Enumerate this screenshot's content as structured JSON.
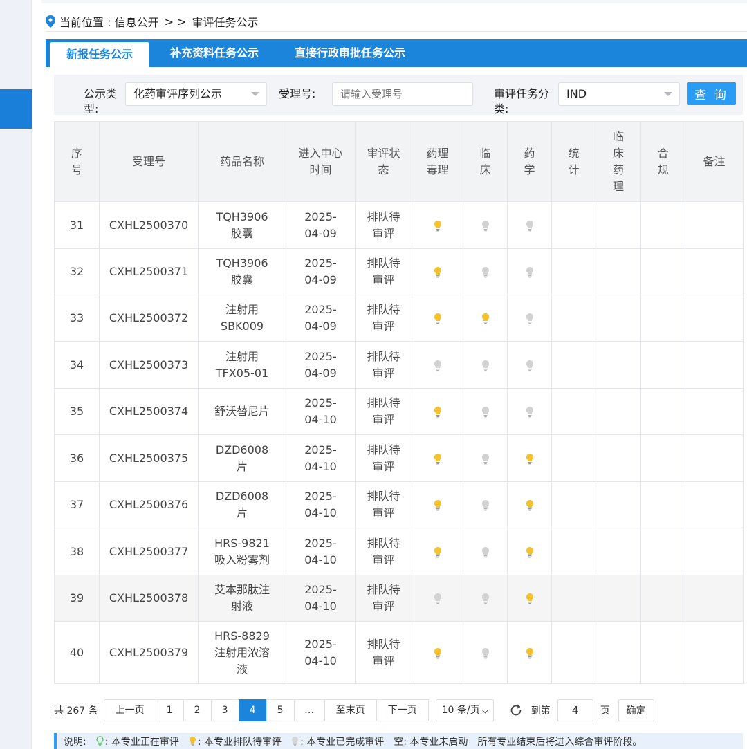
{
  "breadcrumb": {
    "prefix": "当前位置 : 信息公开",
    "sep": "> >",
    "current": "审评任务公示"
  },
  "tabs": [
    "新报任务公示",
    "补充资料任务公示",
    "直接行政审批任务公示"
  ],
  "filter": {
    "type_label": "公示类型:",
    "type_value": "化药审评序列公示",
    "accept_label": "受理号:",
    "accept_placeholder": "请输入受理号",
    "task_label": "审评任务分类:",
    "task_value": "IND",
    "query_button": "查 询"
  },
  "table": {
    "headers": [
      "序号",
      "受理号",
      "药品名称",
      "进入中心时间",
      "审评状态",
      "药理毒理",
      "临床",
      "药学",
      "统计",
      "临床药理",
      "合规",
      "备注"
    ],
    "rows": [
      {
        "no": "31",
        "id": "CXHL2500370",
        "name": "TQH3906胶囊",
        "date": "2025-04-09",
        "status": "排队待审评",
        "tox": "queued",
        "clinic": "done",
        "pharm": "done"
      },
      {
        "no": "32",
        "id": "CXHL2500371",
        "name": "TQH3906胶囊",
        "date": "2025-04-09",
        "status": "排队待审评",
        "tox": "queued",
        "clinic": "done",
        "pharm": "done"
      },
      {
        "no": "33",
        "id": "CXHL2500372",
        "name": "注射用SBK009",
        "date": "2025-04-09",
        "status": "排队待审评",
        "tox": "queued",
        "clinic": "queued",
        "pharm": "done"
      },
      {
        "no": "34",
        "id": "CXHL2500373",
        "name": "注射用TFX05-01",
        "date": "2025-04-09",
        "status": "排队待审评",
        "tox": "done",
        "clinic": "done",
        "pharm": "done"
      },
      {
        "no": "35",
        "id": "CXHL2500374",
        "name": "舒沃替尼片",
        "date": "2025-04-10",
        "status": "排队待审评",
        "tox": "queued",
        "clinic": "done",
        "pharm": "done"
      },
      {
        "no": "36",
        "id": "CXHL2500375",
        "name": "DZD6008片",
        "date": "2025-04-10",
        "status": "排队待审评",
        "tox": "queued",
        "clinic": "done",
        "pharm": "queued"
      },
      {
        "no": "37",
        "id": "CXHL2500376",
        "name": "DZD6008片",
        "date": "2025-04-10",
        "status": "排队待审评",
        "tox": "queued",
        "clinic": "done",
        "pharm": "queued"
      },
      {
        "no": "38",
        "id": "CXHL2500377",
        "name": "HRS-9821吸入粉雾剂",
        "date": "2025-04-10",
        "status": "排队待审评",
        "tox": "queued",
        "clinic": "done",
        "pharm": "queued"
      },
      {
        "no": "39",
        "id": "CXHL2500378",
        "name": "艾本那肽注射液",
        "date": "2025-04-10",
        "status": "排队待审评",
        "tox": "done",
        "clinic": "done",
        "pharm": "queued"
      },
      {
        "no": "40",
        "id": "CXHL2500379",
        "name": "HRS-8829注射用浓溶液",
        "date": "2025-04-10",
        "status": "排队待审评",
        "tox": "queued",
        "clinic": "done",
        "pharm": "queued"
      }
    ]
  },
  "pager": {
    "total": "共 267 条",
    "prev": "上一页",
    "pages": [
      "1",
      "2",
      "3",
      "4",
      "5",
      "…"
    ],
    "current": "4",
    "last": "至末页",
    "next": "下一页",
    "page_size": "10 条/页",
    "goto_label": "到第",
    "goto_value": "4",
    "page_unit": "页",
    "confirm": "确定"
  },
  "legend": {
    "title": "说明:",
    "in_review": ": 本专业正在审评",
    "queued": ": 本专业排队待审评",
    "done": ": 本专业已完成审评",
    "empty": "空: 本专业未启动",
    "note": "所有专业结束后将进入综合审评阶段。"
  },
  "colors": {
    "accent": "#1b85dc",
    "bulb_queued": "#f2c230",
    "bulb_done": "#c8c8c8",
    "bulb_active": "#5cb85c"
  }
}
